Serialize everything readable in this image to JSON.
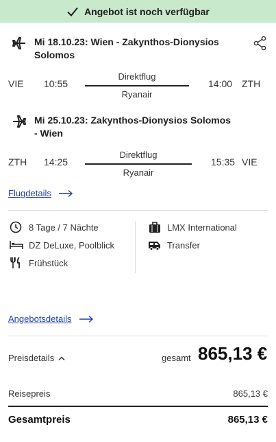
{
  "banner": {
    "text": "Angebot ist noch verfügbar"
  },
  "flights": [
    {
      "title": "Mi 18.10.23: Wien - Zakynthos-Dionysios Solomos",
      "from_code": "VIE",
      "dep_time": "10:55",
      "type": "Direktflug",
      "airline": "Ryanair",
      "arr_time": "14:00",
      "to_code": "ZTH"
    },
    {
      "title": "Mi 25.10.23: Zakynthos-Dionysios Solomos - Wien",
      "from_code": "ZTH",
      "dep_time": "14:25",
      "type": "Direktflug",
      "airline": "Ryanair",
      "arr_time": "15:35",
      "to_code": "VIE"
    }
  ],
  "links": {
    "flight_details": "Flugdetails",
    "offer_details": "Angebotsdetails"
  },
  "features": {
    "duration": "8 Tage / 7 Nächte",
    "room": "DZ DeLuxe, Poolblick",
    "board": "Frühstück",
    "operator": "LMX International",
    "transfer": "Transfer"
  },
  "price": {
    "details_label": "Preisdetails",
    "total_label": "gesamt",
    "total_value": "865,13 €",
    "travel_price_label": "Reisepreis",
    "travel_price_value": "865,13 €",
    "grand_total_label": "Gesamtpreis",
    "grand_total_value": "865,13 €"
  },
  "icons": [
    "check-icon",
    "plane-departure-icon",
    "plane-return-icon",
    "share-icon",
    "arrow-right-icon",
    "clock-icon",
    "bed-icon",
    "cutlery-icon",
    "suitcase-icon",
    "bus-icon",
    "chevron-up-icon"
  ],
  "colors": {
    "banner_bg": "#c9e9cc",
    "link": "#1f3fa8"
  }
}
